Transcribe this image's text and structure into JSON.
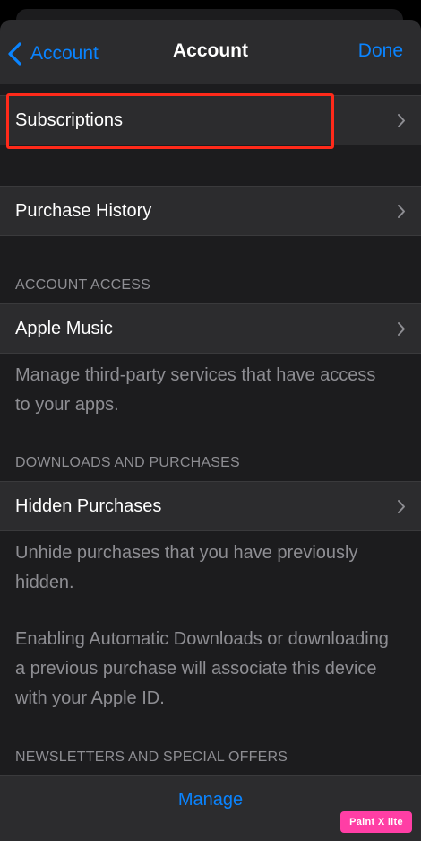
{
  "nav": {
    "back_label": "Account",
    "title": "Account",
    "done_label": "Done"
  },
  "rows": {
    "subscriptions": "Subscriptions",
    "purchase_history": "Purchase History",
    "apple_music": "Apple Music",
    "hidden_purchases": "Hidden Purchases"
  },
  "sections": {
    "account_access": "ACCOUNT ACCESS",
    "downloads_purchases": "DOWNLOADS AND PURCHASES",
    "newsletters": "NEWSLETTERS AND SPECIAL OFFERS"
  },
  "footnotes": {
    "apple_music": "Manage third-party services that have access to your apps.",
    "hidden_purchases": "Unhide purchases that you have previously hidden.",
    "auto_downloads": "Enabling Automatic Downloads or downloading a previous purchase will associate this device with your Apple ID."
  },
  "manage_label": "Manage",
  "watermark": "Paint X lite",
  "colors": {
    "accent": "#0a84ff",
    "highlight": "#ff2a1a"
  },
  "icons": {
    "back": "chevron-left-icon",
    "disclosure": "chevron-right-icon"
  }
}
